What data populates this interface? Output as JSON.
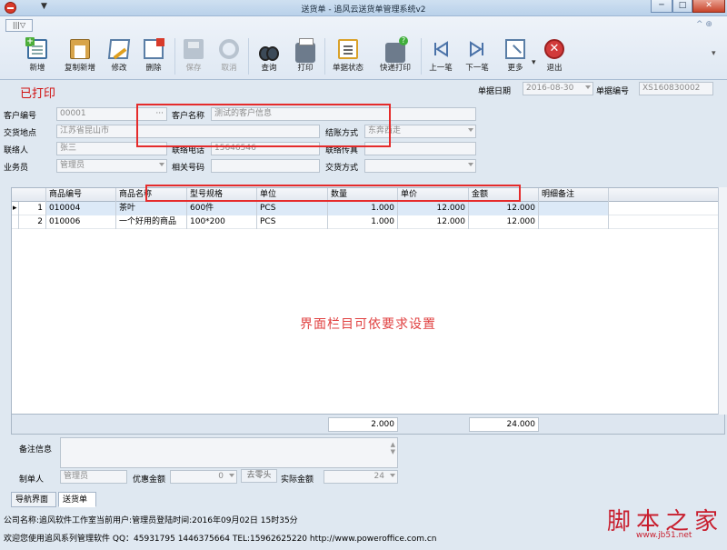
{
  "window": {
    "title": "送货单 - 追风云送货单管理系统v2",
    "min_label": "─",
    "max_label": "□",
    "close_label": "✕"
  },
  "quick_access_label": "▼",
  "ribbon": {
    "tab_label": "|||▽",
    "help_label": "^ ⊕",
    "buttons": [
      {
        "label": "新增",
        "icon": "new-doc-icon",
        "enabled": true
      },
      {
        "label": "复制新增",
        "icon": "copy-new-icon",
        "enabled": true
      },
      {
        "label": "修改",
        "icon": "edit-pencil-icon",
        "enabled": true
      },
      {
        "label": "删除",
        "icon": "delete-icon",
        "enabled": true
      },
      {
        "label": "保存",
        "icon": "save-icon",
        "enabled": false
      },
      {
        "label": "取消",
        "icon": "cancel-icon",
        "enabled": false
      },
      {
        "label": "查询",
        "icon": "binoculars-icon",
        "enabled": true
      },
      {
        "label": "打印",
        "icon": "printer-icon",
        "enabled": true
      },
      {
        "label": "单据状态",
        "icon": "document-status-icon",
        "enabled": true
      },
      {
        "label": "快递打印",
        "icon": "express-print-icon",
        "enabled": true
      },
      {
        "label": "上一笔",
        "icon": "previous-icon",
        "enabled": true
      },
      {
        "label": "下一笔",
        "icon": "next-icon",
        "enabled": true
      },
      {
        "label": "更多",
        "icon": "more-icon",
        "enabled": true
      },
      {
        "label": "退出",
        "icon": "exit-icon",
        "enabled": true
      }
    ],
    "more_dropdown": "▾",
    "overflow": "▾"
  },
  "form": {
    "status_text": "已打印",
    "date_label": "单据日期",
    "date_value": "2016-08-30",
    "doc_no_label": "单据编号",
    "doc_no_value": "XS160830002",
    "customer_code_label": "客户编号",
    "customer_code_value": "00001",
    "customer_name_label": "客户名称",
    "customer_name_value": "测试的客户信息",
    "delivery_place_label": "交货地点",
    "delivery_place_value": "江苏省昆山市",
    "settlement_label": "结账方式",
    "settlement_value": "东奔西走",
    "contact_label": "联络人",
    "contact_value": "张三",
    "phone_label": "联络电话",
    "phone_value": "15646546",
    "fax_label": "联络传真",
    "fax_value": "",
    "salesman_label": "业务员",
    "salesman_value": "管理员",
    "related_no_label": "相关号码",
    "related_no_value": "",
    "delivery_mode_label": "交货方式",
    "delivery_mode_value": ""
  },
  "grid": {
    "columns": [
      "商品编号",
      "商品名称",
      "型号规格",
      "单位",
      "数量",
      "单价",
      "金额",
      "明细备注"
    ],
    "rows": [
      {
        "idx": "1",
        "marker": "▸",
        "code": "010004",
        "name": "茶叶",
        "spec": "600件",
        "unit": "PCS",
        "qty": "1.000",
        "price": "12.000",
        "amount": "12.000",
        "note": ""
      },
      {
        "idx": "2",
        "marker": "",
        "code": "010006",
        "name": "一个好用的商品",
        "spec": "100*200",
        "unit": "PCS",
        "qty": "1.000",
        "price": "12.000",
        "amount": "12.000",
        "note": ""
      }
    ],
    "annotation": "界面栏目可依要求设置",
    "total_qty": "2.000",
    "total_amount": "24.000"
  },
  "bottom": {
    "memo_label": "备注信息",
    "memo_value": "",
    "maker_label": "制单人",
    "maker_value": "管理员",
    "discount_label": "优惠金额",
    "discount_value": "0",
    "round_button": "去零头",
    "actual_label": "实际金额",
    "actual_value": "24"
  },
  "nav_tabs": [
    "导航界面",
    "送货单"
  ],
  "footer": {
    "line1": "公司名称:追风软件工作室当前用户:管理员登陆时间:2016年09月02日 15时35分",
    "line2": "欢迎您使用追风系列管理软件 QQ：45931795 1446375664 TEL:15962625220 http://www.poweroffice.com.cn"
  },
  "watermark": {
    "logo_text": "脚本之家",
    "url": "www.jb51.net"
  },
  "colors": {
    "status_red": "#d01010",
    "annotation_red": "#e52b2b",
    "selected_row": "#dce9f7"
  }
}
